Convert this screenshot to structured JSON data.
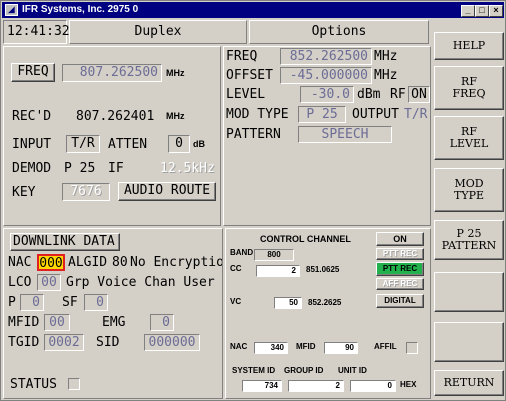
{
  "window": {
    "title": "IFR Systems, Inc. 2975 0",
    "min": "_",
    "max": "□",
    "close": "×"
  },
  "header": {
    "time": "12:41:32",
    "mode": "Duplex",
    "options": "Options"
  },
  "rx": {
    "freq_btn": "FREQ",
    "freq_val": "807.262500",
    "freq_unit": "MHz",
    "recd_label": "REC'D",
    "recd_val": "807.262401",
    "recd_unit": "MHz",
    "input_label": "INPUT",
    "input_val": "T/R",
    "atten_label": "ATTEN",
    "atten_val": "0",
    "atten_unit": "dB",
    "demod_label": "DEMOD",
    "demod_val": "P 25",
    "if_label": "IF",
    "if_val": "12.5kHz",
    "key_label": "KEY",
    "key_val": "7676",
    "audio_route": "AUDIO ROUTE"
  },
  "tx": {
    "freq_label": "FREQ",
    "freq_val": "852.262500",
    "freq_unit": "MHz",
    "offset_label": "OFFSET",
    "offset_val": "-45.000000",
    "offset_unit": "MHz",
    "level_label": "LEVEL",
    "level_val": "-30.0",
    "level_unit": "dBm",
    "rf_label": "RF",
    "rf_val": "ON",
    "modtype_label": "MOD TYPE",
    "modtype_val": "P 25",
    "output_label": "OUTPUT",
    "output_val": "T/R",
    "pattern_label": "PATTERN",
    "pattern_val": "SPEECH"
  },
  "downlink": {
    "title": "DOWNLINK DATA",
    "nac_label": "NAC",
    "nac_val": "000",
    "algid_label": "ALGID",
    "algid_val": "80",
    "algid_desc": "No Encryptio",
    "lco_label": "LCO",
    "lco_val": "00",
    "lco_desc": "Grp Voice Chan User",
    "p_label": "P",
    "p_val": "0",
    "sf_label": "SF",
    "sf_val": "0",
    "mfid_label": "MFID",
    "mfid_val": "00",
    "emg_label": "EMG",
    "emg_val": "0",
    "tgid_label": "TGID",
    "tgid_val": "0002",
    "sid_label": "SID",
    "sid_val": "000000",
    "status_label": "STATUS"
  },
  "control": {
    "title": "CONTROL CHANNEL",
    "on_btn": "ON",
    "band_label": "BAND",
    "band_val": "800",
    "cc_label": "CC",
    "cc_val": "2",
    "cc_freq": "851.0625",
    "vc_label": "VC",
    "vc_val": "50",
    "vc_freq": "852.2625",
    "ptt_rec": "PTT REC",
    "aff_rec": "AFF REC",
    "digital": "DIGITAL",
    "top_right": "PTT REC",
    "nac_label": "NAC",
    "nac_val": "340",
    "mfid_label": "MFID",
    "mfid_val": "90",
    "affil_label": "AFFIL",
    "sysid_label": "SYSTEM ID",
    "groupid_label": "GROUP ID",
    "unitid_label": "UNIT ID",
    "sysid_val": "734",
    "groupid_val": "2",
    "unitid_val": "0",
    "hex": "HEX",
    "colors": {
      "ptt_rec": "#22b14c"
    }
  },
  "side": {
    "help": "HELP",
    "rf_freq": "RF\nFREQ",
    "rf_level": "RF\nLEVEL",
    "mod_type": "MOD\nTYPE",
    "p25_pattern": "P 25\nPATTERN",
    "blank1": "",
    "blank2": "",
    "return": "RETURN"
  }
}
